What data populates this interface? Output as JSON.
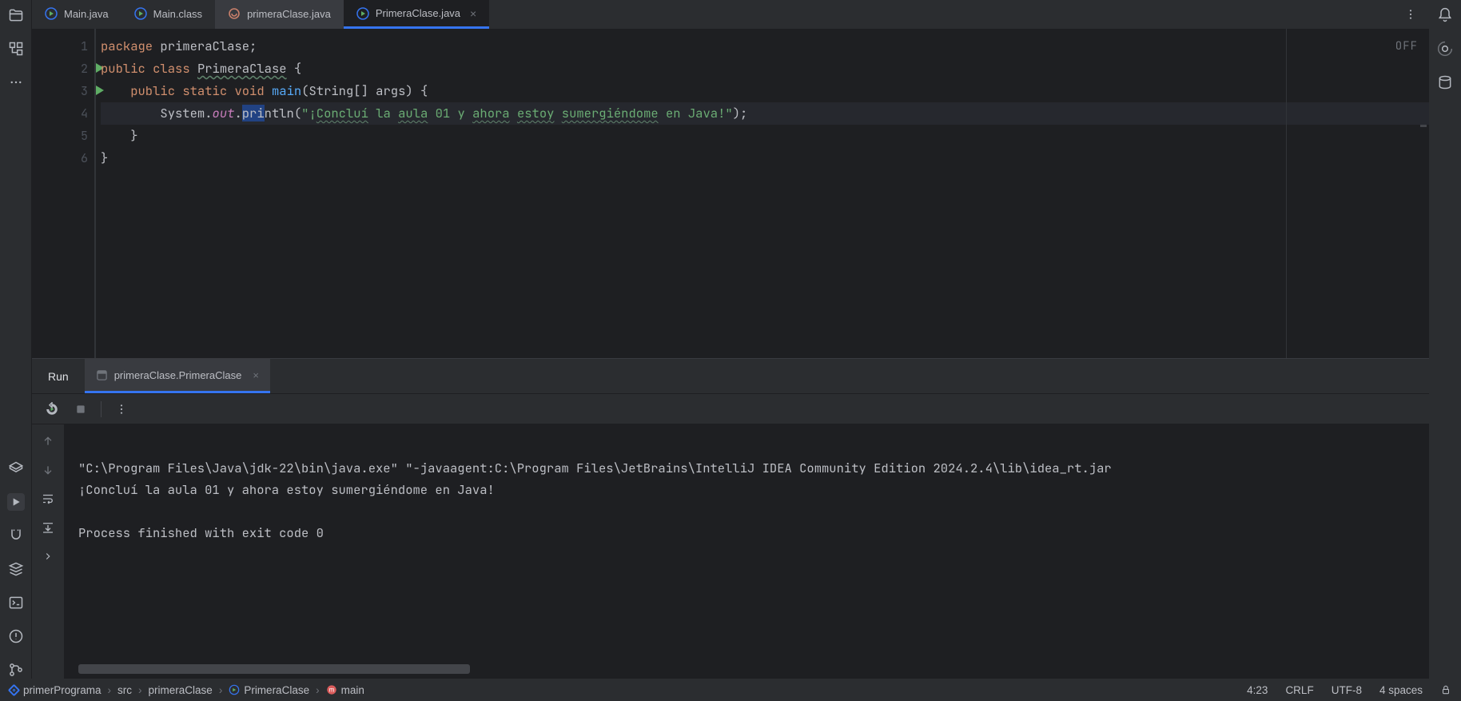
{
  "tabs": [
    {
      "label": "Main.java",
      "icon": "java-run",
      "active": false
    },
    {
      "label": "Main.class",
      "icon": "java-run",
      "active": false
    },
    {
      "label": "primeraClase.java",
      "icon": "java-plain",
      "active": false,
      "dim": true
    },
    {
      "label": "PrimeraClase.java",
      "icon": "java-run",
      "active": true,
      "closeable": true
    }
  ],
  "editor": {
    "off_badge": "OFF",
    "lines": [
      "1",
      "2",
      "3",
      "4",
      "5",
      "6"
    ],
    "run_markers": [
      2,
      3
    ],
    "code": {
      "package_kw": "package",
      "package_name": "primeraClase",
      "public_kw": "public",
      "class_kw": "class",
      "class_name": "PrimeraClase",
      "static_kw": "static",
      "void_kw": "void",
      "main_name": "main",
      "args": "(String[] args)",
      "sys": "System",
      "out": "out",
      "println": "println",
      "string_pre": "\"¡",
      "squiggle_a": "Concluí",
      "sp1": " la ",
      "squiggle_b": "aula",
      "sp2": " 01 y ",
      "squiggle_c": "ahora",
      "sp3": " ",
      "squiggle_d": "estoy",
      "sp4": " ",
      "squiggle_e": "sumergiéndome",
      "string_post": " en Java!\"",
      "paren_close": ");"
    }
  },
  "run": {
    "title": "Run",
    "tab": "primeraClase.PrimeraClase",
    "console": [
      "\"C:\\Program Files\\Java\\jdk-22\\bin\\java.exe\" \"-javaagent:C:\\Program Files\\JetBrains\\IntelliJ IDEA Community Edition 2024.2.4\\lib\\idea_rt.jar",
      "¡Concluí la aula 01 y ahora estoy sumergiéndome en Java!",
      "",
      "Process finished with exit code 0"
    ]
  },
  "status": {
    "crumbs": [
      "primerPrograma",
      "src",
      "primeraClase",
      "PrimeraClase",
      "main"
    ],
    "caret": "4:23",
    "line_sep": "CRLF",
    "encoding": "UTF-8",
    "indent": "4 spaces"
  }
}
